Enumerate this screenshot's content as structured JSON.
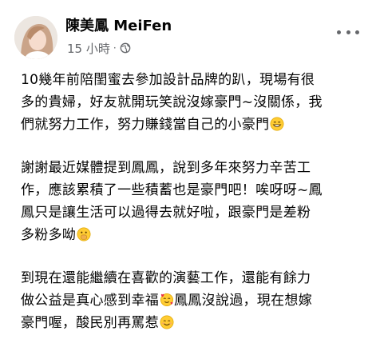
{
  "post": {
    "author_name": "陳美鳳 MeiFen",
    "timestamp": "15 小時",
    "separator": "·",
    "privacy_icon": "globe-icon",
    "more_icon": "more-options-icon",
    "paragraphs": [
      {
        "lines": [
          "10幾年前陪閨蜜去參加設計品牌的趴，現場有很",
          "多的貴婦，好友就開玩笑說沒嫁豪門~沒關係，我",
          "們就努力工作，努力賺錢當自己的小豪門"
        ],
        "end_emoji": "grinning-face-emoji"
      },
      {
        "lines": [
          "謝謝最近媒體提到鳳鳳，說到多年來努力辛苦工",
          "作，應該累積了一些積蓄也是豪門吧！唉呀呀~鳳",
          "鳳只是讓生活可以過得去就好啦，跟豪門是差粉",
          "多粉多呦"
        ],
        "end_emoji": "face-with-hand-over-mouth-emoji"
      },
      {
        "line1": "到現在還能繼續在喜歡的演藝工作，還能有餘力",
        "line2_before": "做公益是真心感到幸福",
        "line2_emoji": "smiling-face-with-hearts-emoji",
        "line2_after": "鳳鳳沒說過，現在想嫁",
        "line3": "豪門喔，酸民別再罵惹",
        "end_emoji": "smiling-face-emoji"
      }
    ]
  }
}
